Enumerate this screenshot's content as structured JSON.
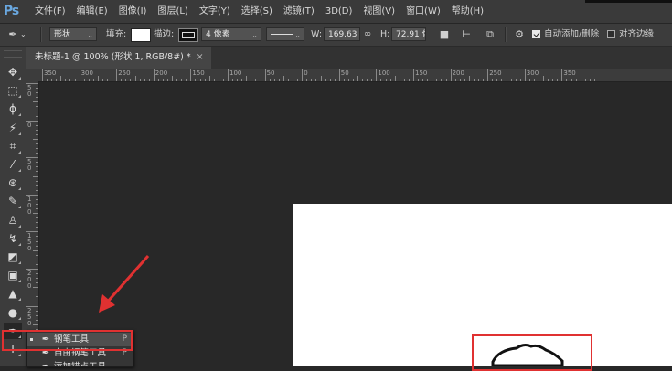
{
  "app": {
    "logo": "Ps"
  },
  "menu": [
    "文件(F)",
    "编辑(E)",
    "图像(I)",
    "图层(L)",
    "文字(Y)",
    "选择(S)",
    "滤镜(T)",
    "3D(D)",
    "视图(V)",
    "窗口(W)",
    "帮助(H)"
  ],
  "options": {
    "tool_mode": "形状",
    "fill_label": "填充:",
    "stroke_label": "描边:",
    "stroke_width": "4 像素",
    "w_label": "W:",
    "w_value": "169.63 |",
    "h_label": "H:",
    "h_value": "72.91 像",
    "auto_add_delete": {
      "label": "自动添加/删除",
      "checked": true
    },
    "align_edges": {
      "label": "对齐边缘",
      "checked": false
    }
  },
  "document_tab": {
    "title": "未标题-1 @ 100% (形状 1, RGB/8#) *",
    "close": "×"
  },
  "ruler_h": [
    "350",
    "300",
    "250",
    "200",
    "150",
    "100",
    "50",
    "0",
    "50",
    "100",
    "150",
    "200",
    "250",
    "300",
    "350"
  ],
  "ruler_v": [
    "50",
    "0",
    "50",
    "100",
    "150",
    "200",
    "250",
    "300"
  ],
  "tools": [
    {
      "name": "move-tool",
      "icon": "move-icon",
      "glyph": "✥"
    },
    {
      "name": "marquee-tool",
      "icon": "marquee-icon",
      "glyph": "⬚"
    },
    {
      "name": "lasso-tool",
      "icon": "lasso-icon",
      "glyph": "ϕ"
    },
    {
      "name": "quick-select-tool",
      "icon": "magic-wand-icon",
      "glyph": "⚡"
    },
    {
      "name": "crop-tool",
      "icon": "crop-icon",
      "glyph": "⌗"
    },
    {
      "name": "eyedropper-tool",
      "icon": "eyedropper-icon",
      "glyph": "⁄"
    },
    {
      "name": "healing-brush-tool",
      "icon": "bandage-icon",
      "glyph": "⊛"
    },
    {
      "name": "brush-tool",
      "icon": "brush-icon",
      "glyph": "✎"
    },
    {
      "name": "clone-stamp-tool",
      "icon": "stamp-icon",
      "glyph": "♙"
    },
    {
      "name": "history-brush-tool",
      "icon": "history-brush-icon",
      "glyph": "↯"
    },
    {
      "name": "eraser-tool",
      "icon": "eraser-icon",
      "glyph": "◩"
    },
    {
      "name": "gradient-tool",
      "icon": "gradient-icon",
      "glyph": "▣"
    },
    {
      "name": "blur-tool",
      "icon": "blur-icon",
      "glyph": "▲"
    },
    {
      "name": "dodge-tool",
      "icon": "dodge-icon",
      "glyph": "●"
    },
    {
      "name": "pen-tool",
      "icon": "pen-icon",
      "glyph": "✒"
    },
    {
      "name": "type-tool",
      "icon": "type-icon",
      "glyph": "T"
    }
  ],
  "flyout": [
    {
      "label": "钢笔工具",
      "key": "P",
      "selected": true
    },
    {
      "label": "自由钢笔工具",
      "key": "P",
      "selected": false
    },
    {
      "label": "添加锚点工具",
      "key": "",
      "selected": false
    }
  ],
  "colors": {
    "highlight": "#e03131",
    "canvas": "#ffffff",
    "workspace": "#282828",
    "logo": "#6aa8e0"
  }
}
